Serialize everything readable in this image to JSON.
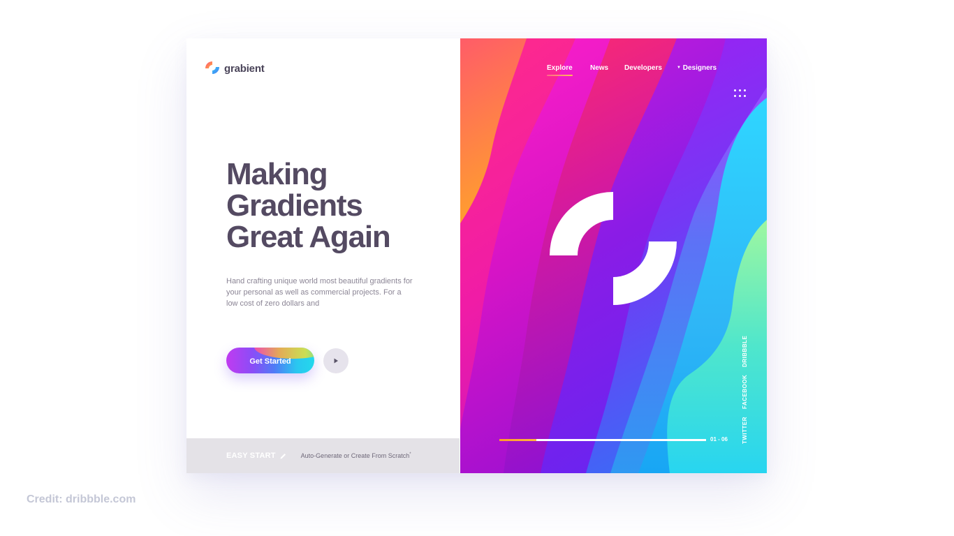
{
  "brand": {
    "name": "grabient"
  },
  "hero": {
    "headline": [
      "Making",
      "Gradients",
      "Great Again"
    ],
    "description": "Hand crafting unique world most beautiful gradients for your personal as well as commercial projects. For a low cost of zero dollars and",
    "cta_label": "Get Started"
  },
  "footer": {
    "easy_start": "EASY START",
    "note": "Auto-Generate or Create From Scratch",
    "note_mark": "*"
  },
  "nav": {
    "items": [
      {
        "label": "Explore",
        "active": true
      },
      {
        "label": "News",
        "active": false
      },
      {
        "label": "Developers",
        "active": false
      },
      {
        "label": "Designers",
        "active": false,
        "dropdown_icon": "caret-down-icon"
      }
    ],
    "menu_icon": "grid-dots-icon"
  },
  "slider": {
    "counter": "01 - 06",
    "progress": 0.18
  },
  "social": [
    "DRIBBBLE",
    "FACEBOOK",
    "TWITTER"
  ],
  "credit": "Credit: dribbble.com",
  "colors": {
    "heading": "#544a62",
    "body_text": "#8b8595",
    "footer_bg": "#e4e2e7",
    "progress_accent": "#ffa530",
    "gradient_pink": "#ff1fa0",
    "gradient_purple": "#7a2df0",
    "gradient_cyan": "#2cd8f4"
  }
}
